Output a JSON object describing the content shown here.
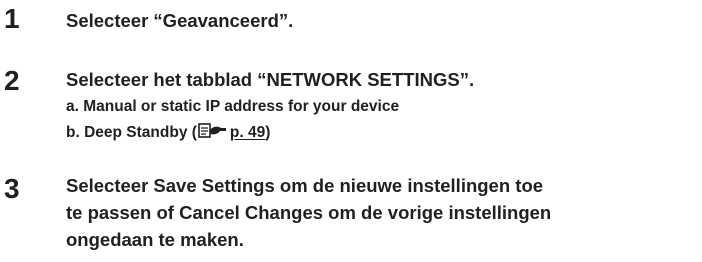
{
  "steps": [
    {
      "number": "1",
      "lines": [
        "Selecteer “Geavanceerd”."
      ]
    },
    {
      "number": "2",
      "lines": [
        "Selecteer het tabblad “NETWORK SETTINGS”."
      ],
      "sub_items": {
        "a": "a. Manual or static IP address for your device",
        "b_prefix": "b. Deep Standby (",
        "b_icon": "page-reference-icon",
        "b_link": "p. 49",
        "b_suffix": ")"
      }
    },
    {
      "number": "3",
      "lines": [
        "Selecteer Save Settings om de nieuwe instellingen toe",
        "te passen of Cancel Changes om de vorige instellingen",
        "ongedaan te maken."
      ]
    }
  ]
}
